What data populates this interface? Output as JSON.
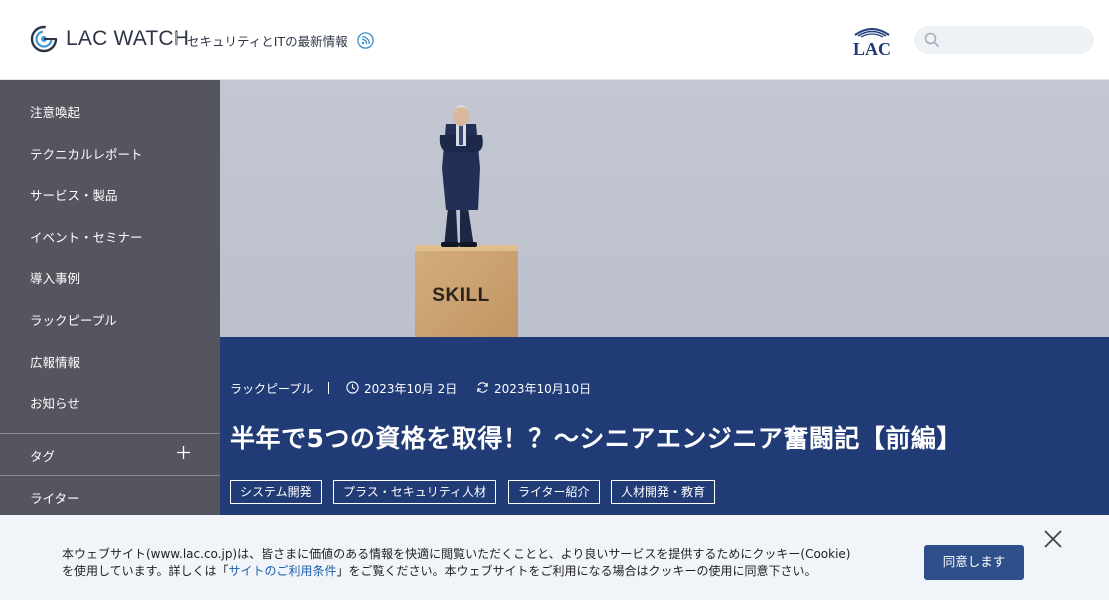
{
  "header": {
    "logo_text": "LAC WATCH",
    "tagline": "セキュリティとITの最新情報",
    "brand_logo_text": "LAC",
    "search": {
      "placeholder": ""
    }
  },
  "sidebar": {
    "items": [
      {
        "label": "注意喚起"
      },
      {
        "label": "テクニカルレポート"
      },
      {
        "label": "サービス・製品"
      },
      {
        "label": "イベント・セミナー"
      },
      {
        "label": "導入事例"
      },
      {
        "label": "ラックピープル"
      },
      {
        "label": "広報情報"
      },
      {
        "label": "お知らせ"
      }
    ],
    "tag_label": "タグ",
    "writer_label": "ライター"
  },
  "article": {
    "hero_block_text": "SKILL",
    "category": "ラックピープル",
    "published": "2023年10月 2日",
    "updated": "2023年10月10日",
    "title": "半年で5つの資格を取得！？～シニアエンジニア奮闘記【前編】",
    "tags": [
      "システム開発",
      "プラス・セキュリティ人材",
      "ライター紹介",
      "人材開発・教育"
    ]
  },
  "cookie": {
    "line1": "本ウェブサイト(www.lac.co.jp)は、皆さまに価値のある情報を快適に閲覧いただくことと、より良いサービスを提供するためにクッキー(Cookie)",
    "line2_before": "を使用しています。詳しくは「",
    "link_text": "サイトのご利用条件",
    "line2_after": "」をご覧ください。本ウェブサイトをご利用になる場合はクッキーの使用に同意下さい。",
    "agree_label": "同意します"
  },
  "colors": {
    "sidebar_bg": "#55555f",
    "title_panel_bg": "#203b76",
    "accent_button": "#2e4f89",
    "link": "#1d5fae"
  },
  "icons": [
    "logo-mark-icon",
    "rss-icon",
    "search-icon",
    "plus-icon",
    "clock-icon",
    "refresh-icon",
    "close-icon"
  ]
}
